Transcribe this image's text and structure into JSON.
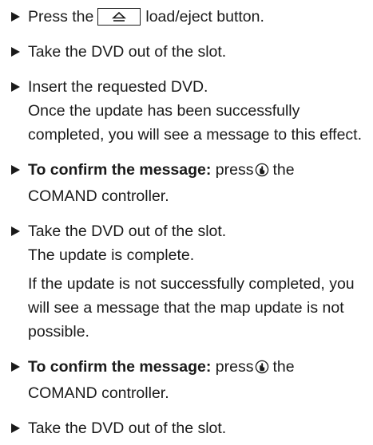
{
  "steps": [
    {
      "lines": [
        "Press the",
        "load/eject button."
      ],
      "key_icon": "eject-key-icon"
    },
    {
      "lines": [
        "Take the DVD out of the slot."
      ]
    },
    {
      "lines": [
        "Insert the requested DVD."
      ],
      "note": "Once the update has been successfully completed, you will see a message to this effect."
    },
    {
      "bold": "To confirm the message:",
      "text": "press",
      "icon": "comand-controller-press-icon",
      "after": "the COMAND controller."
    },
    {
      "lines": [
        "Take the DVD out of the slot."
      ],
      "note": "The update is complete.",
      "note2": "If the update is not successfully completed, you will see a message that the map update is not possible."
    },
    {
      "bold": "To confirm the message:",
      "text": "press",
      "icon": "comand-controller-press-icon",
      "after": "the COMAND controller."
    },
    {
      "lines": [
        "Take the DVD out of the slot."
      ]
    }
  ]
}
